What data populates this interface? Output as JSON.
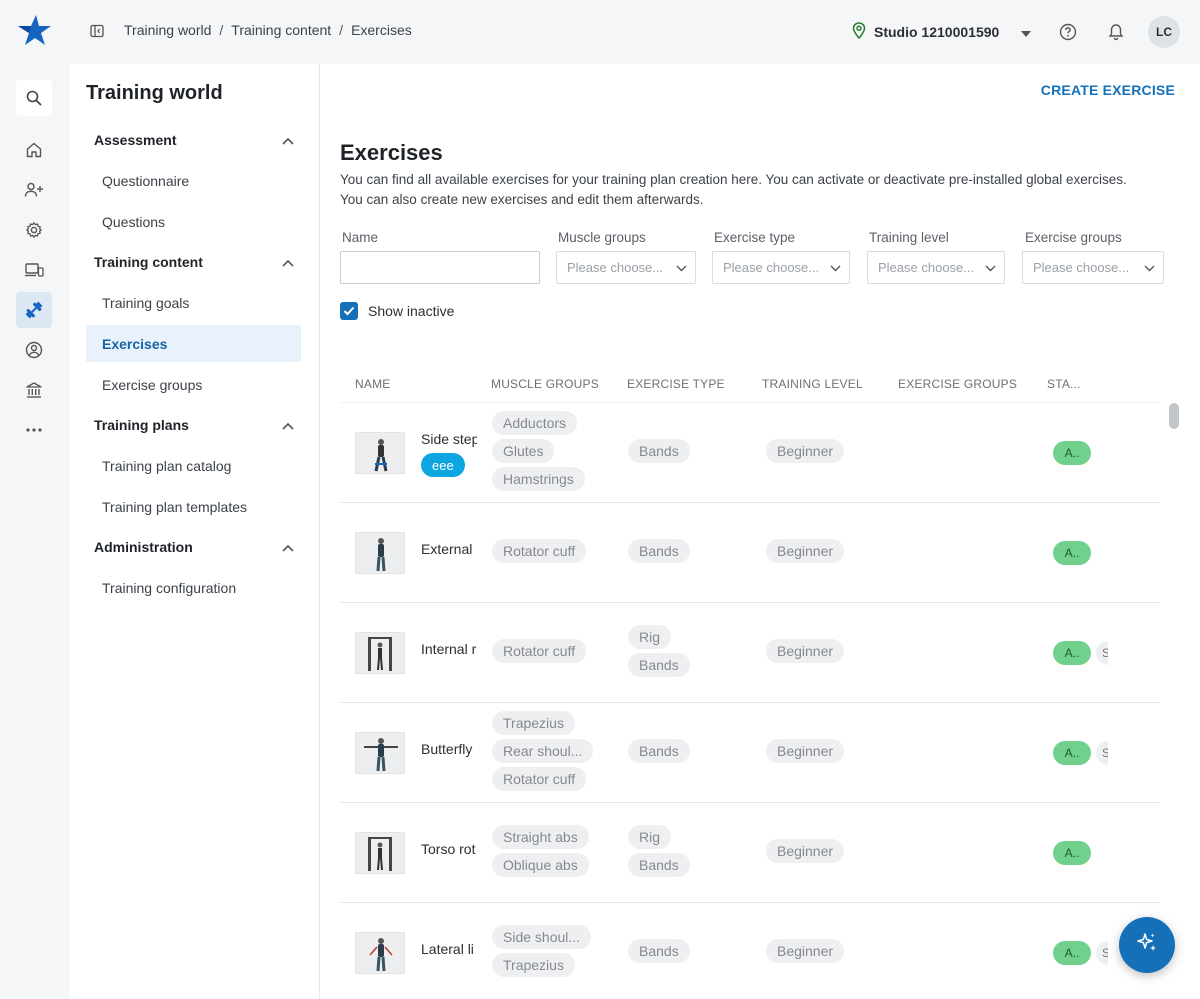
{
  "breadcrumb": {
    "item1": "Training world",
    "item2": "Training content",
    "item3": "Exercises",
    "sep": "/"
  },
  "header": {
    "studio": "Studio 1210001590",
    "avatar": "LC"
  },
  "sidenav": {
    "title": "Training world",
    "sections": {
      "assessment": "Assessment",
      "training_content": "Training content",
      "training_plans": "Training plans",
      "administration": "Administration"
    },
    "items": {
      "questionnaire": "Questionnaire",
      "questions": "Questions",
      "training_goals": "Training goals",
      "exercises": "Exercises",
      "exercise_groups": "Exercise groups",
      "training_plan_catalog": "Training plan catalog",
      "training_plan_templates": "Training plan templates",
      "training_configuration": "Training configuration"
    }
  },
  "main": {
    "create_button": "CREATE EXERCISE",
    "title": "Exercises",
    "description": "You can find all available exercises for your training plan creation here. You can activate or deactivate pre-installed global exercises. You can also create new exercises and edit them afterwards.",
    "filters": {
      "name_label": "Name",
      "name_value": "",
      "muscle_groups_label": "Muscle groups",
      "exercise_type_label": "Exercise type",
      "training_level_label": "Training level",
      "exercise_groups_label": "Exercise groups",
      "placeholder": "Please choose..."
    },
    "show_inactive": {
      "label": "Show inactive",
      "checked": true
    }
  },
  "table": {
    "columns": {
      "name": "NAME",
      "muscle_groups": "MUSCLE GROUPS",
      "exercise_type": "EXERCISE TYPE",
      "training_level": "TRAINING LEVEL",
      "exercise_groups": "EXERCISE GROUPS",
      "status": "STA..."
    },
    "rows": [
      {
        "name": "Side step",
        "tag": "eee",
        "muscles": [
          "Adductors",
          "Glutes",
          "Hamstrings"
        ],
        "types": [
          "Bands"
        ],
        "level": "Beginner",
        "status": "A..",
        "more": ""
      },
      {
        "name": "External",
        "muscles": [
          "Rotator cuff"
        ],
        "types": [
          "Bands"
        ],
        "level": "Beginner",
        "status": "A..",
        "more": ""
      },
      {
        "name": "Internal r",
        "muscles": [
          "Rotator cuff"
        ],
        "types": [
          "Rig",
          "Bands"
        ],
        "level": "Beginner",
        "status": "A..",
        "more": "S"
      },
      {
        "name": "Butterfly",
        "muscles": [
          "Trapezius",
          "Rear shoul...",
          "Rotator cuff"
        ],
        "types": [
          "Bands"
        ],
        "level": "Beginner",
        "status": "A..",
        "more": "S"
      },
      {
        "name": "Torso rot",
        "muscles": [
          "Straight abs",
          "Oblique abs"
        ],
        "types": [
          "Rig",
          "Bands"
        ],
        "level": "Beginner",
        "status": "A..",
        "more": ""
      },
      {
        "name": "Lateral li",
        "muscles": [
          "Side shoul...",
          "Trapezius"
        ],
        "types": [
          "Bands"
        ],
        "level": "Beginner",
        "status": "A..",
        "more": "S"
      }
    ]
  },
  "colors": {
    "accent": "#1670b8",
    "status_active": "#72d08e",
    "tag": "#0ea6e0"
  },
  "icons": [
    "logo-star-icon",
    "sidebar-toggle-icon",
    "location-pin-icon",
    "chevron-down-icon",
    "help-icon",
    "bell-icon",
    "search-icon",
    "home-icon",
    "add-user-icon",
    "gear-icon",
    "devices-icon",
    "dumbbell-icon",
    "user-circle-icon",
    "bank-icon",
    "more-icon",
    "sparkle-icon"
  ]
}
